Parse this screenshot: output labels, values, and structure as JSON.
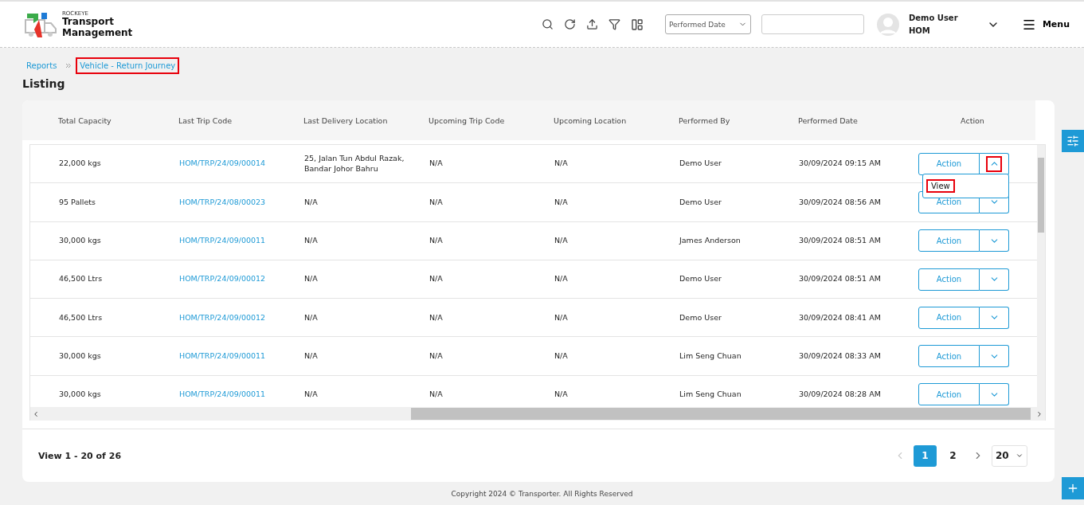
{
  "brand": {
    "company": "ROCKEYE",
    "title_line1": "Transport",
    "title_line2": "Management"
  },
  "toolbar": {
    "date_field": {
      "value": "Performed Date"
    }
  },
  "user": {
    "name": "Demo User",
    "org": "HOM"
  },
  "menu": {
    "label": "Menu"
  },
  "breadcrumbs": [
    {
      "label": "Reports",
      "highlighted": false
    },
    {
      "label": "Vehicle - Return Journey",
      "highlighted": true
    }
  ],
  "page_title": "Listing",
  "table": {
    "columns": [
      "Total Capacity",
      "Last Trip Code",
      "Last Delivery Location",
      "Upcoming Trip Code",
      "Upcoming Location",
      "Performed By",
      "Performed Date",
      "Action"
    ],
    "rows": [
      {
        "capacity": "22,000 kgs",
        "trip_code": "HOM/TRP/24/09/00014",
        "delivery_location": "25, Jalan Tun Abdul Razak, Bandar Johor Bahru",
        "upcoming_trip_code": "N/A",
        "upcoming_location": "N/A",
        "performed_by": "Demo User",
        "performed_date": "30/09/2024 09:15 AM",
        "action": "Action",
        "expanded": true,
        "toggle_highlighted": true,
        "menu": [
          {
            "label": "View",
            "highlighted": true
          }
        ]
      },
      {
        "capacity": "95 Pallets",
        "trip_code": "HOM/TRP/24/08/00023",
        "delivery_location": "N/A",
        "upcoming_trip_code": "N/A",
        "upcoming_location": "N/A",
        "performed_by": "Demo User",
        "performed_date": "30/09/2024 08:56 AM",
        "action": "Action",
        "expanded": false,
        "toggle_highlighted": false
      },
      {
        "capacity": "30,000 kgs",
        "trip_code": "HOM/TRP/24/09/00011",
        "delivery_location": "N/A",
        "upcoming_trip_code": "N/A",
        "upcoming_location": "N/A",
        "performed_by": "James Anderson",
        "performed_date": "30/09/2024 08:51 AM",
        "action": "Action",
        "expanded": false,
        "toggle_highlighted": false
      },
      {
        "capacity": "46,500 Ltrs",
        "trip_code": "HOM/TRP/24/09/00012",
        "delivery_location": "N/A",
        "upcoming_trip_code": "N/A",
        "upcoming_location": "N/A",
        "performed_by": "Demo User",
        "performed_date": "30/09/2024 08:51 AM",
        "action": "Action",
        "expanded": false,
        "toggle_highlighted": false
      },
      {
        "capacity": "46,500 Ltrs",
        "trip_code": "HOM/TRP/24/09/00012",
        "delivery_location": "N/A",
        "upcoming_trip_code": "N/A",
        "upcoming_location": "N/A",
        "performed_by": "Demo User",
        "performed_date": "30/09/2024 08:41 AM",
        "action": "Action",
        "expanded": false,
        "toggle_highlighted": false
      },
      {
        "capacity": "30,000 kgs",
        "trip_code": "HOM/TRP/24/09/00011",
        "delivery_location": "N/A",
        "upcoming_trip_code": "N/A",
        "upcoming_location": "N/A",
        "performed_by": "Lim Seng Chuan",
        "performed_date": "30/09/2024 08:33 AM",
        "action": "Action",
        "expanded": false,
        "toggle_highlighted": false
      },
      {
        "capacity": "30,000 kgs",
        "trip_code": "HOM/TRP/24/09/00011",
        "delivery_location": "N/A",
        "upcoming_trip_code": "N/A",
        "upcoming_location": "N/A",
        "performed_by": "Lim Seng Chuan",
        "performed_date": "30/09/2024 08:28 AM",
        "action": "Action",
        "expanded": false,
        "toggle_highlighted": false
      }
    ]
  },
  "pagination": {
    "summary": "View 1 - 20 of 26",
    "pages": [
      {
        "label": "1",
        "selected": true
      },
      {
        "label": "2",
        "selected": false
      }
    ],
    "page_size": "20"
  },
  "footer": "Copyright 2024 © Transporter. All Rights Reserved"
}
